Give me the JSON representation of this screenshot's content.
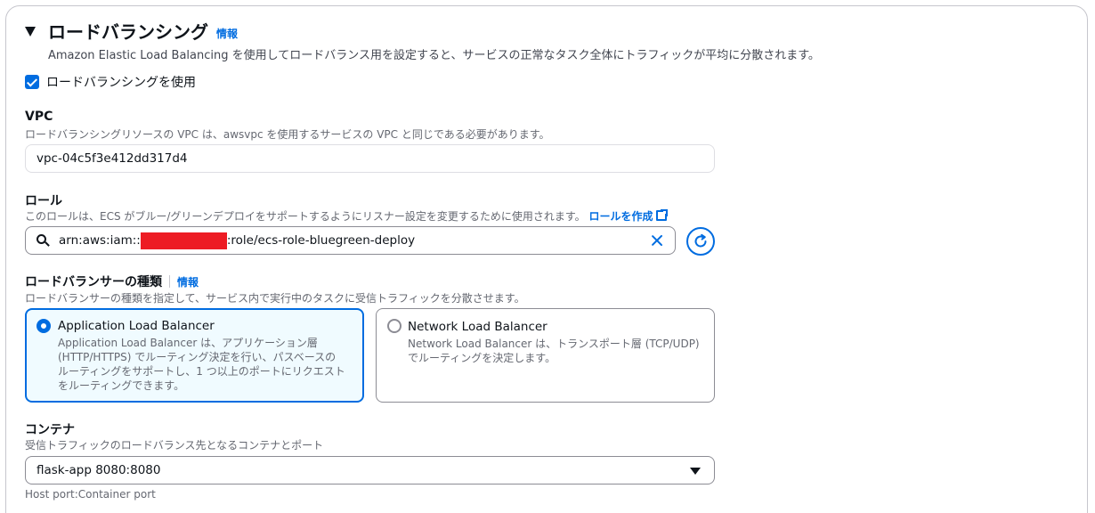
{
  "section": {
    "title": "ロードバランシング",
    "info": "情報",
    "description": "Amazon Elastic Load Balancing を使用してロードバランス用を設定すると、サービスの正常なタスク全体にトラフィックが平均に分散されます。"
  },
  "use_lb": {
    "label": "ロードバランシングを使用",
    "checked": true
  },
  "vpc": {
    "label": "VPC",
    "description": "ロードバランシングリソースの VPC は、awsvpc を使用するサービスの VPC と同じである必要があります。",
    "value": "vpc-04c5f3e412dd317d4"
  },
  "role": {
    "label": "ロール",
    "description": "このロールは、ECS がブルー/グリーンデプロイをサポートするようにリスナー設定を変更するために使用されます。",
    "create_link": "ロールを作成",
    "value_prefix": "arn:aws:iam::",
    "value_suffix": ":role/ecs-role-bluegreen-deploy"
  },
  "lb_type": {
    "label": "ロードバランサーの種類",
    "info": "情報",
    "description": "ロードバランサーの種類を指定して、サービス内で実行中のタスクに受信トラフィックを分散させます。",
    "options": [
      {
        "title": "Application Load Balancer",
        "description": "Application Load Balancer は、アプリケーション層 (HTTP/HTTPS) でルーティング決定を行い、パスベースのルーティングをサポートし、1 つ以上のポートにリクエストをルーティングできます。",
        "selected": true
      },
      {
        "title": "Network Load Balancer",
        "description": "Network Load Balancer は、トランスポート層 (TCP/UDP) でルーティングを決定します。",
        "selected": false
      }
    ]
  },
  "container": {
    "label": "コンテナ",
    "description": "受信トラフィックのロードバランス先となるコンテナとポート",
    "selected": "flask-app 8080:8080",
    "hint": "Host port:Container port"
  },
  "colors": {
    "accent": "#006ce0",
    "redaction": "#ed1c24",
    "selected_tile_bg": "#f0fbff"
  },
  "icons": [
    "caret-down-icon",
    "checkbox-checked-icon",
    "external-link-icon",
    "search-icon",
    "clear-icon",
    "refresh-icon",
    "radio-selected-icon",
    "radio-unselected-icon",
    "dropdown-caret-icon"
  ]
}
